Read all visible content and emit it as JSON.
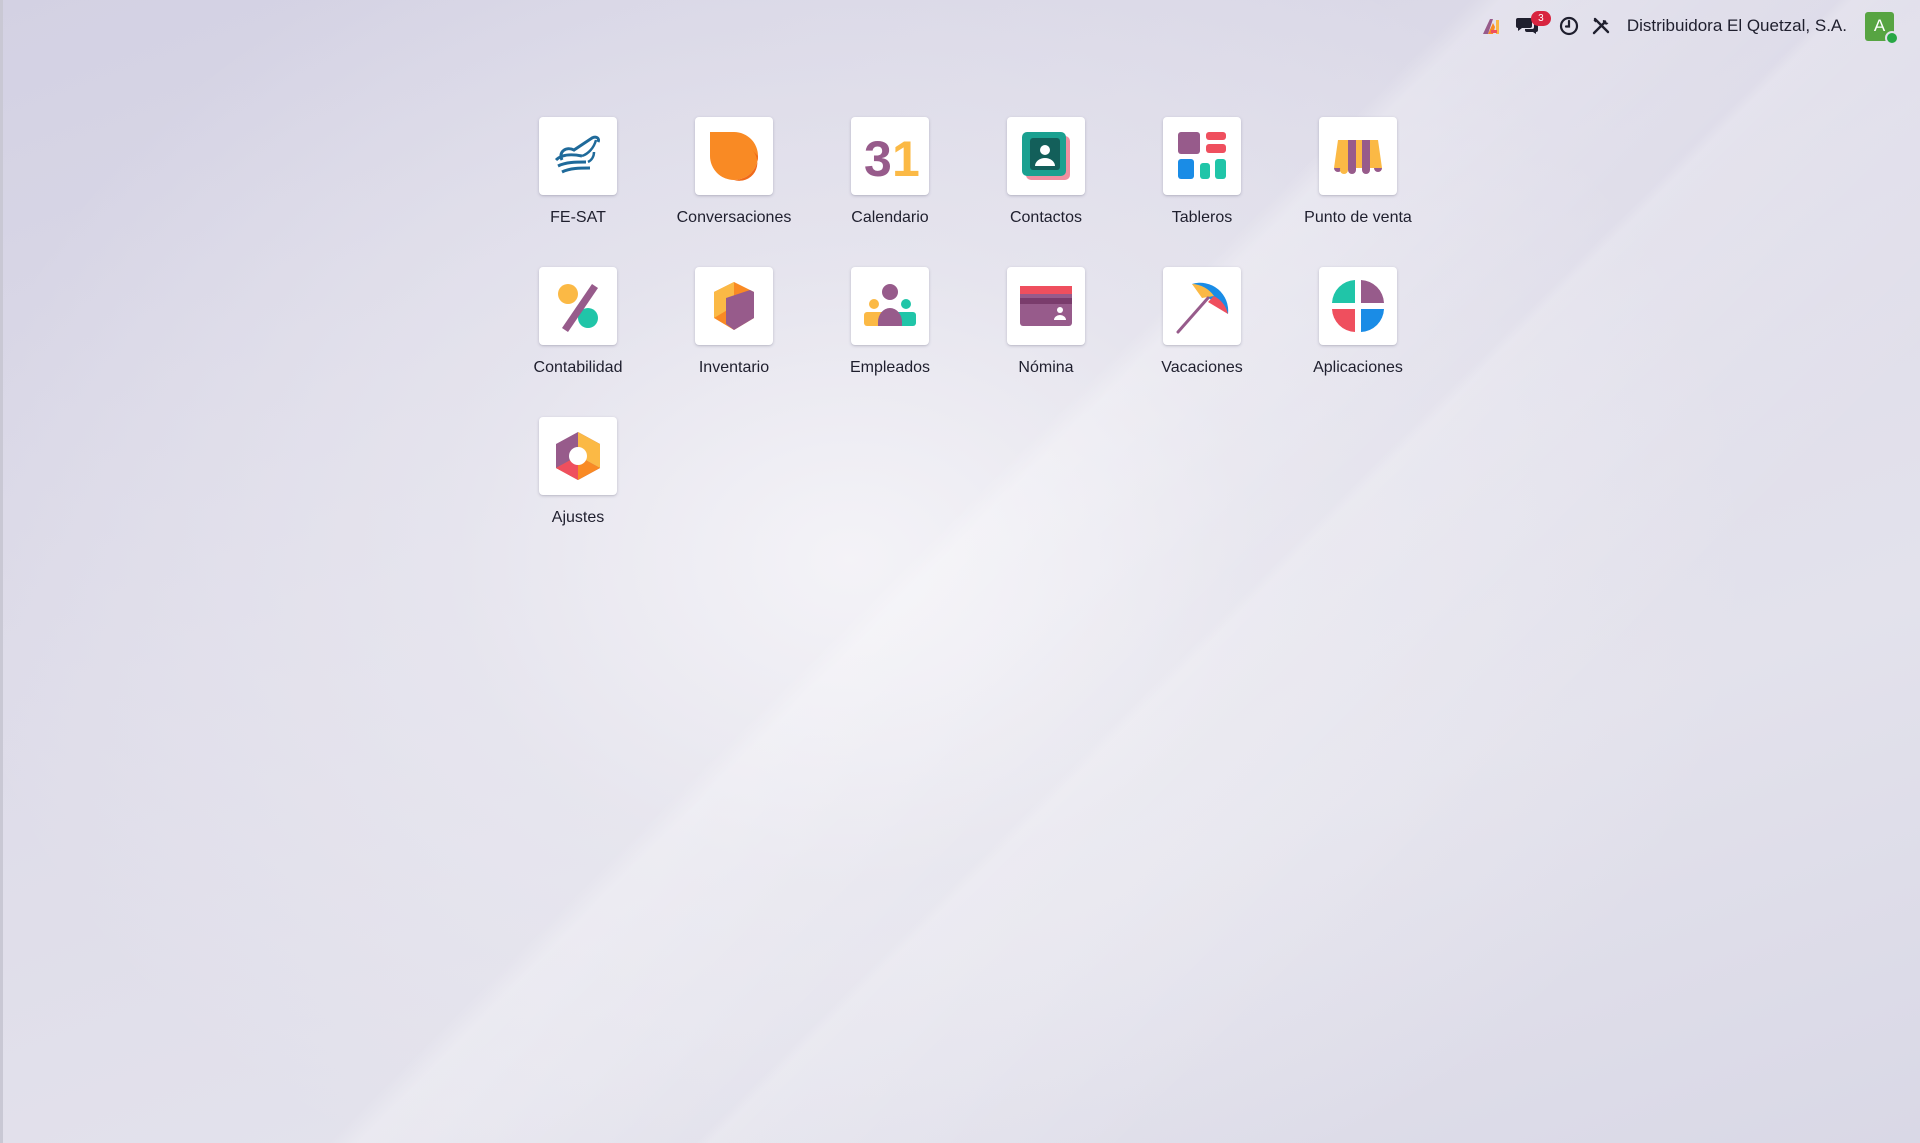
{
  "topbar": {
    "company": "Distribuidora El Quetzal, S.A.",
    "messages_badge": "3",
    "avatar_initial": "A",
    "icons": [
      "odoo-logo-icon",
      "chat-icon",
      "clock-icon",
      "tools-icon"
    ]
  },
  "apps": [
    {
      "label": "FE-SAT",
      "icon": "fe-sat-icon"
    },
    {
      "label": "Conversaciones",
      "icon": "conversations-icon"
    },
    {
      "label": "Calendario",
      "icon": "calendar-icon"
    },
    {
      "label": "Contactos",
      "icon": "contacts-icon"
    },
    {
      "label": "Tableros",
      "icon": "dashboards-icon"
    },
    {
      "label": "Punto de venta",
      "icon": "point-of-sale-icon"
    },
    {
      "label": "Contabilidad",
      "icon": "accounting-icon"
    },
    {
      "label": "Inventario",
      "icon": "inventory-icon"
    },
    {
      "label": "Empleados",
      "icon": "employees-icon"
    },
    {
      "label": "Nómina",
      "icon": "payroll-icon"
    },
    {
      "label": "Vacaciones",
      "icon": "time-off-icon"
    },
    {
      "label": "Aplicaciones",
      "icon": "apps-icon"
    },
    {
      "label": "Ajustes",
      "icon": "settings-icon"
    }
  ],
  "colors": {
    "purple": "#975b8b",
    "orange": "#f98a24",
    "yellow": "#fbb945",
    "teal": "#20c5a8",
    "blue": "#1a8ce6",
    "red": "#ef4f5e",
    "avatar": "#57a442"
  }
}
